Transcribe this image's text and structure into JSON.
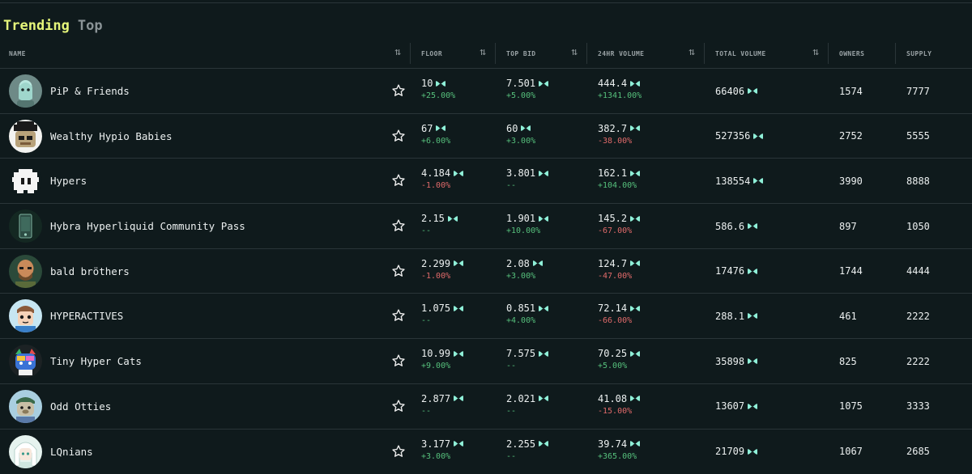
{
  "tabs": [
    {
      "label": "Trending",
      "active": true
    },
    {
      "label": "Top",
      "active": false
    }
  ],
  "columns": {
    "name": "NAME",
    "floor": "FLOOR",
    "top_bid": "TOP BID",
    "vol24": "24HR VOLUME",
    "total_volume": "TOTAL VOLUME",
    "owners": "OWNERS",
    "supply": "SUPPLY"
  },
  "colors": {
    "background": "#0f1a1c",
    "active_tab": "#e5f57a",
    "positive": "#56c07c",
    "negative": "#e06a6a",
    "currency": "#8ff0d8"
  },
  "rows": [
    {
      "name": "PiP & Friends",
      "avatar": "pip-avatar",
      "floor": "10",
      "floor_chg": "+25.00%",
      "floor_dir": "up",
      "top_bid": "7.501",
      "top_bid_chg": "+5.00%",
      "top_bid_dir": "up",
      "vol24": "444.4",
      "vol24_chg": "+1341.00%",
      "vol24_dir": "up",
      "total_volume": "66406",
      "owners": "1574",
      "supply": "7777"
    },
    {
      "name": "Wealthy Hypio Babies",
      "avatar": "hypio-avatar",
      "floor": "67",
      "floor_chg": "+6.00%",
      "floor_dir": "up",
      "top_bid": "60",
      "top_bid_chg": "+3.00%",
      "top_bid_dir": "up",
      "vol24": "382.7",
      "vol24_chg": "-38.00%",
      "vol24_dir": "down",
      "total_volume": "527356",
      "owners": "2752",
      "supply": "5555"
    },
    {
      "name": "Hypers",
      "avatar": "hypers-avatar",
      "floor": "4.184",
      "floor_chg": "-1.00%",
      "floor_dir": "down",
      "top_bid": "3.801",
      "top_bid_chg": "--",
      "top_bid_dir": "flat",
      "vol24": "162.1",
      "vol24_chg": "+104.00%",
      "vol24_dir": "up",
      "total_volume": "138554",
      "owners": "3990",
      "supply": "8888"
    },
    {
      "name": "Hybra Hyperliquid Community Pass",
      "avatar": "hybra-avatar",
      "floor": "2.15",
      "floor_chg": "--",
      "floor_dir": "flat",
      "top_bid": "1.901",
      "top_bid_chg": "+10.00%",
      "top_bid_dir": "up",
      "vol24": "145.2",
      "vol24_chg": "-67.00%",
      "vol24_dir": "down",
      "total_volume": "586.6",
      "owners": "897",
      "supply": "1050"
    },
    {
      "name": "bald bröthers",
      "avatar": "bald-avatar",
      "floor": "2.299",
      "floor_chg": "-1.00%",
      "floor_dir": "down",
      "top_bid": "2.08",
      "top_bid_chg": "+3.00%",
      "top_bid_dir": "up",
      "vol24": "124.7",
      "vol24_chg": "-47.00%",
      "vol24_dir": "down",
      "total_volume": "17476",
      "owners": "1744",
      "supply": "4444"
    },
    {
      "name": "HYPERACTIVES",
      "avatar": "hyperactives-avatar",
      "floor": "1.075",
      "floor_chg": "--",
      "floor_dir": "flat",
      "top_bid": "0.851",
      "top_bid_chg": "+4.00%",
      "top_bid_dir": "up",
      "vol24": "72.14",
      "vol24_chg": "-66.00%",
      "vol24_dir": "down",
      "total_volume": "288.1",
      "owners": "461",
      "supply": "2222"
    },
    {
      "name": "Tiny Hyper Cats",
      "avatar": "cats-avatar",
      "floor": "10.99",
      "floor_chg": "+9.00%",
      "floor_dir": "up",
      "top_bid": "7.575",
      "top_bid_chg": "--",
      "top_bid_dir": "flat",
      "vol24": "70.25",
      "vol24_chg": "+5.00%",
      "vol24_dir": "up",
      "total_volume": "35898",
      "owners": "825",
      "supply": "2222"
    },
    {
      "name": "Odd Otties",
      "avatar": "otties-avatar",
      "floor": "2.877",
      "floor_chg": "--",
      "floor_dir": "flat",
      "top_bid": "2.021",
      "top_bid_chg": "--",
      "top_bid_dir": "flat",
      "vol24": "41.08",
      "vol24_chg": "-15.00%",
      "vol24_dir": "down",
      "total_volume": "13607",
      "owners": "1075",
      "supply": "3333"
    },
    {
      "name": "LQnians",
      "avatar": "lqnians-avatar",
      "floor": "3.177",
      "floor_chg": "+3.00%",
      "floor_dir": "up",
      "top_bid": "2.255",
      "top_bid_chg": "--",
      "top_bid_dir": "flat",
      "vol24": "39.74",
      "vol24_chg": "+365.00%",
      "vol24_dir": "up",
      "total_volume": "21709",
      "owners": "1067",
      "supply": "2685"
    }
  ]
}
